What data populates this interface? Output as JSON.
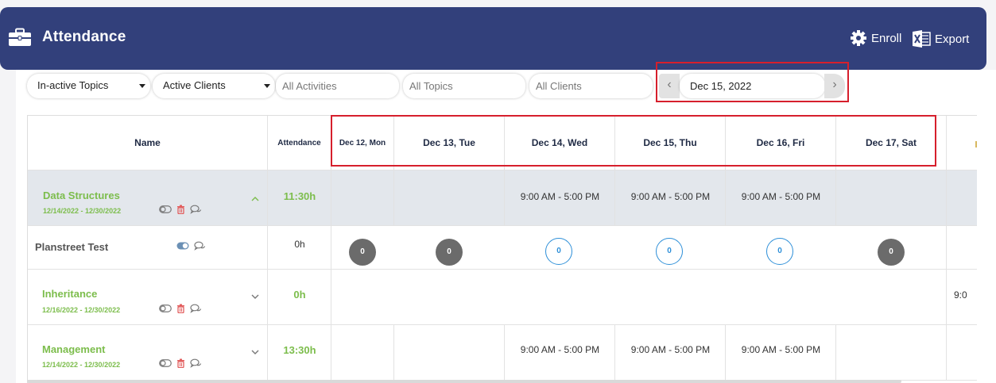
{
  "header": {
    "title": "Attendance",
    "enroll_label": "Enroll",
    "export_label": "Export",
    "background": "#32407b"
  },
  "filters": {
    "topics_select": "In-active Topics",
    "clients_select": "Active Clients",
    "activities_placeholder": "All Activities",
    "topics_placeholder": "All Topics",
    "clients_placeholder": "All Clients",
    "date_value": "Dec 15, 2022"
  },
  "table": {
    "headers": {
      "name": "Name",
      "attendance": "Attendance",
      "days": [
        "Dec 12, Mon",
        "Dec 13, Tue",
        "Dec 14, Wed",
        "Dec 15, Thu",
        "Dec 16, Fri",
        "Dec 17, Sat"
      ]
    },
    "groups": [
      {
        "name": "Data Structures",
        "dates": "12/14/2022 - 12/30/2022",
        "hours": "11:30h",
        "times": [
          "",
          "",
          "9:00 AM - 5:00 PM",
          "9:00 AM - 5:00 PM",
          "9:00 AM - 5:00 PM",
          ""
        ]
      },
      {
        "name": "Inheritance",
        "dates": "12/16/2022 - 12/30/2022",
        "hours": "0h",
        "extra_time_partial": "9:0"
      },
      {
        "name": "Management",
        "dates": "12/14/2022 - 12/30/2022",
        "hours": "13:30h",
        "times": [
          "",
          "",
          "9:00 AM - 5:00 PM",
          "9:00 AM - 5:00 PM",
          "9:00 AM - 5:00 PM",
          ""
        ]
      }
    ],
    "student": {
      "name": "Planstreet Test",
      "hours": "0h",
      "counts": [
        "0",
        "0",
        "0",
        "0",
        "0",
        "0"
      ]
    }
  },
  "colors": {
    "accent_green": "#7cbd4c",
    "highlight_red": "#d61f2c",
    "count_blue": "#2d8fd8",
    "count_grey": "#6b6b6b"
  }
}
